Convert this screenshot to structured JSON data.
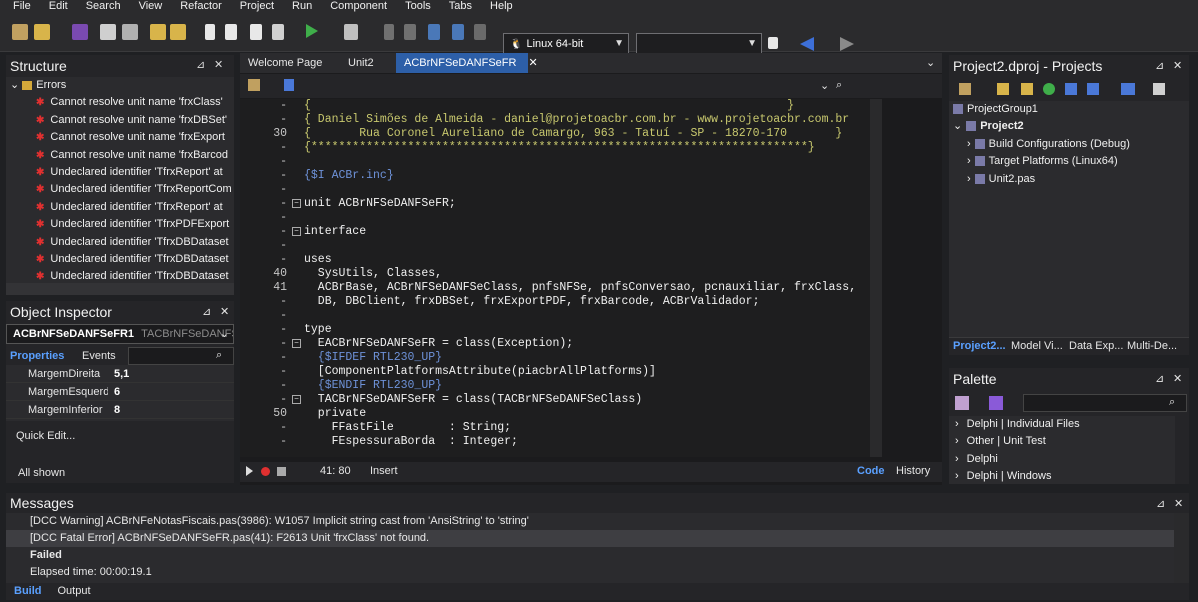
{
  "menu": [
    "File",
    "Edit",
    "Search",
    "View",
    "Refactor",
    "Project",
    "Run",
    "Component",
    "Tools",
    "Tabs",
    "Help"
  ],
  "toolbar": {
    "platform": "Linux 64-bit",
    "config": ""
  },
  "structure": {
    "title": "Structure",
    "root": "Errors",
    "items": [
      "Cannot resolve unit name 'frxClass'",
      "Cannot resolve unit name 'frxDBSet'",
      "Cannot resolve unit name 'frxExport",
      "Cannot resolve unit name 'frxBarcod",
      "Undeclared identifier 'TfrxReport' at",
      "Undeclared identifier 'TfrxReportCom",
      "Undeclared identifier 'TfrxReport' at",
      "Undeclared identifier 'TfrxPDFExport",
      "Undeclared identifier 'TfrxDBDataset",
      "Undeclared identifier 'TfrxDBDataset",
      "Undeclared identifier 'TfrxDBDataset"
    ]
  },
  "inspector": {
    "title": "Object Inspector",
    "object": "ACBrNFSeDANFSeFR1",
    "object_type": "TACBrNFSeDANFSe",
    "tabs": [
      "Properties",
      "Events"
    ],
    "props": [
      {
        "name": "MargemDireita",
        "value": "5,1"
      },
      {
        "name": "MargemEsquerd",
        "value": "6"
      },
      {
        "name": "MargemInferior",
        "value": "8"
      }
    ],
    "quick_edit": "Quick Edit...",
    "all_shown": "All shown"
  },
  "editor": {
    "tabs": [
      "Welcome Page",
      "Unit2",
      "ACBrNFSeDANFSeFR"
    ],
    "active_tab": "ACBrNFSeDANFSeFR",
    "lines": [
      {
        "n": "-",
        "t": "{                                                                     }",
        "c": "cm"
      },
      {
        "n": "-",
        "t": "{ Daniel Simões de Almeida - daniel@projetoacbr.com.br - www.projetoacbr.com.br",
        "c": "cm"
      },
      {
        "n": "30",
        "t": "{       Rua Coronel Aureliano de Camargo, 963 - Tatuí - SP - 18270-170       }",
        "c": "cm"
      },
      {
        "n": "-",
        "t": "{************************************************************************}",
        "c": "cm"
      },
      {
        "n": "-",
        "t": "",
        "c": ""
      },
      {
        "n": "-",
        "t": "{$I ACBr.inc}",
        "c": "dir"
      },
      {
        "n": "-",
        "t": "",
        "c": ""
      },
      {
        "n": "-",
        "t": "unit ACBrNFSeDANFSeFR;",
        "c": "kw",
        "fold": true
      },
      {
        "n": "-",
        "t": "",
        "c": ""
      },
      {
        "n": "-",
        "t": "interface",
        "c": "kw",
        "fold": true
      },
      {
        "n": "-",
        "t": "",
        "c": ""
      },
      {
        "n": "-",
        "t": "uses",
        "c": "kw"
      },
      {
        "n": "40",
        "t": "  SysUtils, Classes,",
        "c": "kw"
      },
      {
        "n": "41",
        "t": "  ACBrBase, ACBrNFSeDANFSeClass, pnfsNFSe, pnfsConversao, pcnauxiliar, frxClass,",
        "c": "kw"
      },
      {
        "n": "-",
        "t": "  DB, DBClient, frxDBSet, frxExportPDF, frxBarcode, ACBrValidador;",
        "c": "kw"
      },
      {
        "n": "-",
        "t": "",
        "c": ""
      },
      {
        "n": "-",
        "t": "type",
        "c": "kw"
      },
      {
        "n": "-",
        "t": "  EACBrNFSeDANFSeFR = class(Exception);",
        "c": "kw",
        "fold": true
      },
      {
        "n": "-",
        "t": "  {$IFDEF RTL230_UP}",
        "c": "dir"
      },
      {
        "n": "-",
        "t": "  [ComponentPlatformsAttribute(piacbrAllPlatforms)]",
        "c": "kw"
      },
      {
        "n": "-",
        "t": "  {$ENDIF RTL230_UP}",
        "c": "dir"
      },
      {
        "n": "-",
        "t": "  TACBrNFSeDANFSeFR = class(TACBrNFSeDANFSeClass)",
        "c": "kw",
        "fold": true
      },
      {
        "n": "50",
        "t": "  private",
        "c": "kw"
      },
      {
        "n": "-",
        "t": "    FFastFile        : String;",
        "c": "kw"
      },
      {
        "n": "-",
        "t": "    FEspessuraBorda  : Integer;",
        "c": "kw"
      }
    ],
    "status": {
      "position": "41: 80",
      "mode": "Insert",
      "tab_code": "Code",
      "tab_history": "History"
    }
  },
  "projects": {
    "title": "Project2.dproj - Projects",
    "items": [
      {
        "label": "ProjectGroup1",
        "level": 0,
        "bold": false
      },
      {
        "label": "Project2",
        "level": 0,
        "bold": true
      },
      {
        "label": "Build Configurations (Debug)",
        "level": 1,
        "bold": false
      },
      {
        "label": "Target Platforms (Linux64)",
        "level": 1,
        "bold": false
      },
      {
        "label": "Unit2.pas",
        "level": 1,
        "bold": false
      }
    ],
    "tabs": [
      "Project2...",
      "Model Vi...",
      "Data Exp...",
      "Multi-De..."
    ]
  },
  "palette": {
    "title": "Palette",
    "items": [
      "Delphi | Individual Files",
      "Other | Unit Test",
      "Delphi",
      "Delphi | Windows"
    ]
  },
  "messages": {
    "title": "Messages",
    "rows": [
      {
        "text": "[DCC Warning] ACBrNFeNotasFiscais.pas(3986): W1057 Implicit string cast from 'AnsiString' to 'string'",
        "bold": false,
        "sel": false
      },
      {
        "text": "[DCC Fatal Error] ACBrNFSeDANFSeFR.pas(41): F2613 Unit 'frxClass' not found.",
        "bold": false,
        "sel": true
      },
      {
        "text": "Failed",
        "bold": true,
        "sel": false
      },
      {
        "text": "Elapsed time: 00:00:19.1",
        "bold": false,
        "sel": false
      }
    ],
    "tabs": [
      "Build",
      "Output"
    ]
  }
}
